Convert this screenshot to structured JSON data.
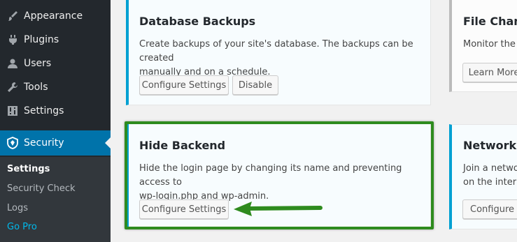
{
  "sidebar": {
    "items": [
      {
        "label": "Appearance",
        "icon": "paintbrush-icon"
      },
      {
        "label": "Plugins",
        "icon": "plug-icon"
      },
      {
        "label": "Users",
        "icon": "user-icon"
      },
      {
        "label": "Tools",
        "icon": "wrench-icon"
      },
      {
        "label": "Settings",
        "icon": "sliders-icon"
      },
      {
        "label": "Security",
        "icon": "shield-icon"
      }
    ],
    "submenu": [
      "Settings",
      "Security Check",
      "Logs",
      "Go Pro"
    ]
  },
  "cards": {
    "database_backups": {
      "title": "Database Backups",
      "desc_line1": "Create backups of your site's database. The backups can be created",
      "desc_line2": "manually and on a schedule.",
      "configure": "Configure Settings",
      "disable": "Disable"
    },
    "file_change": {
      "title": "File Change",
      "desc": "Monitor the s",
      "learn_more": "Learn More"
    },
    "hide_backend": {
      "title": "Hide Backend",
      "desc_line1": "Hide the login page by changing its name and preventing access to",
      "desc_line2": "wp-login.php and wp-admin.",
      "configure": "Configure Settings"
    },
    "network": {
      "title": "Network B",
      "desc_line1": "Join a networ",
      "desc_line2": "on the intern",
      "configure": "Configure S"
    }
  },
  "colors": {
    "sidebar_bg": "#23282d",
    "active": "#0073aa",
    "card_accent": "#00a0d2",
    "highlight": "#2e8b1e"
  }
}
